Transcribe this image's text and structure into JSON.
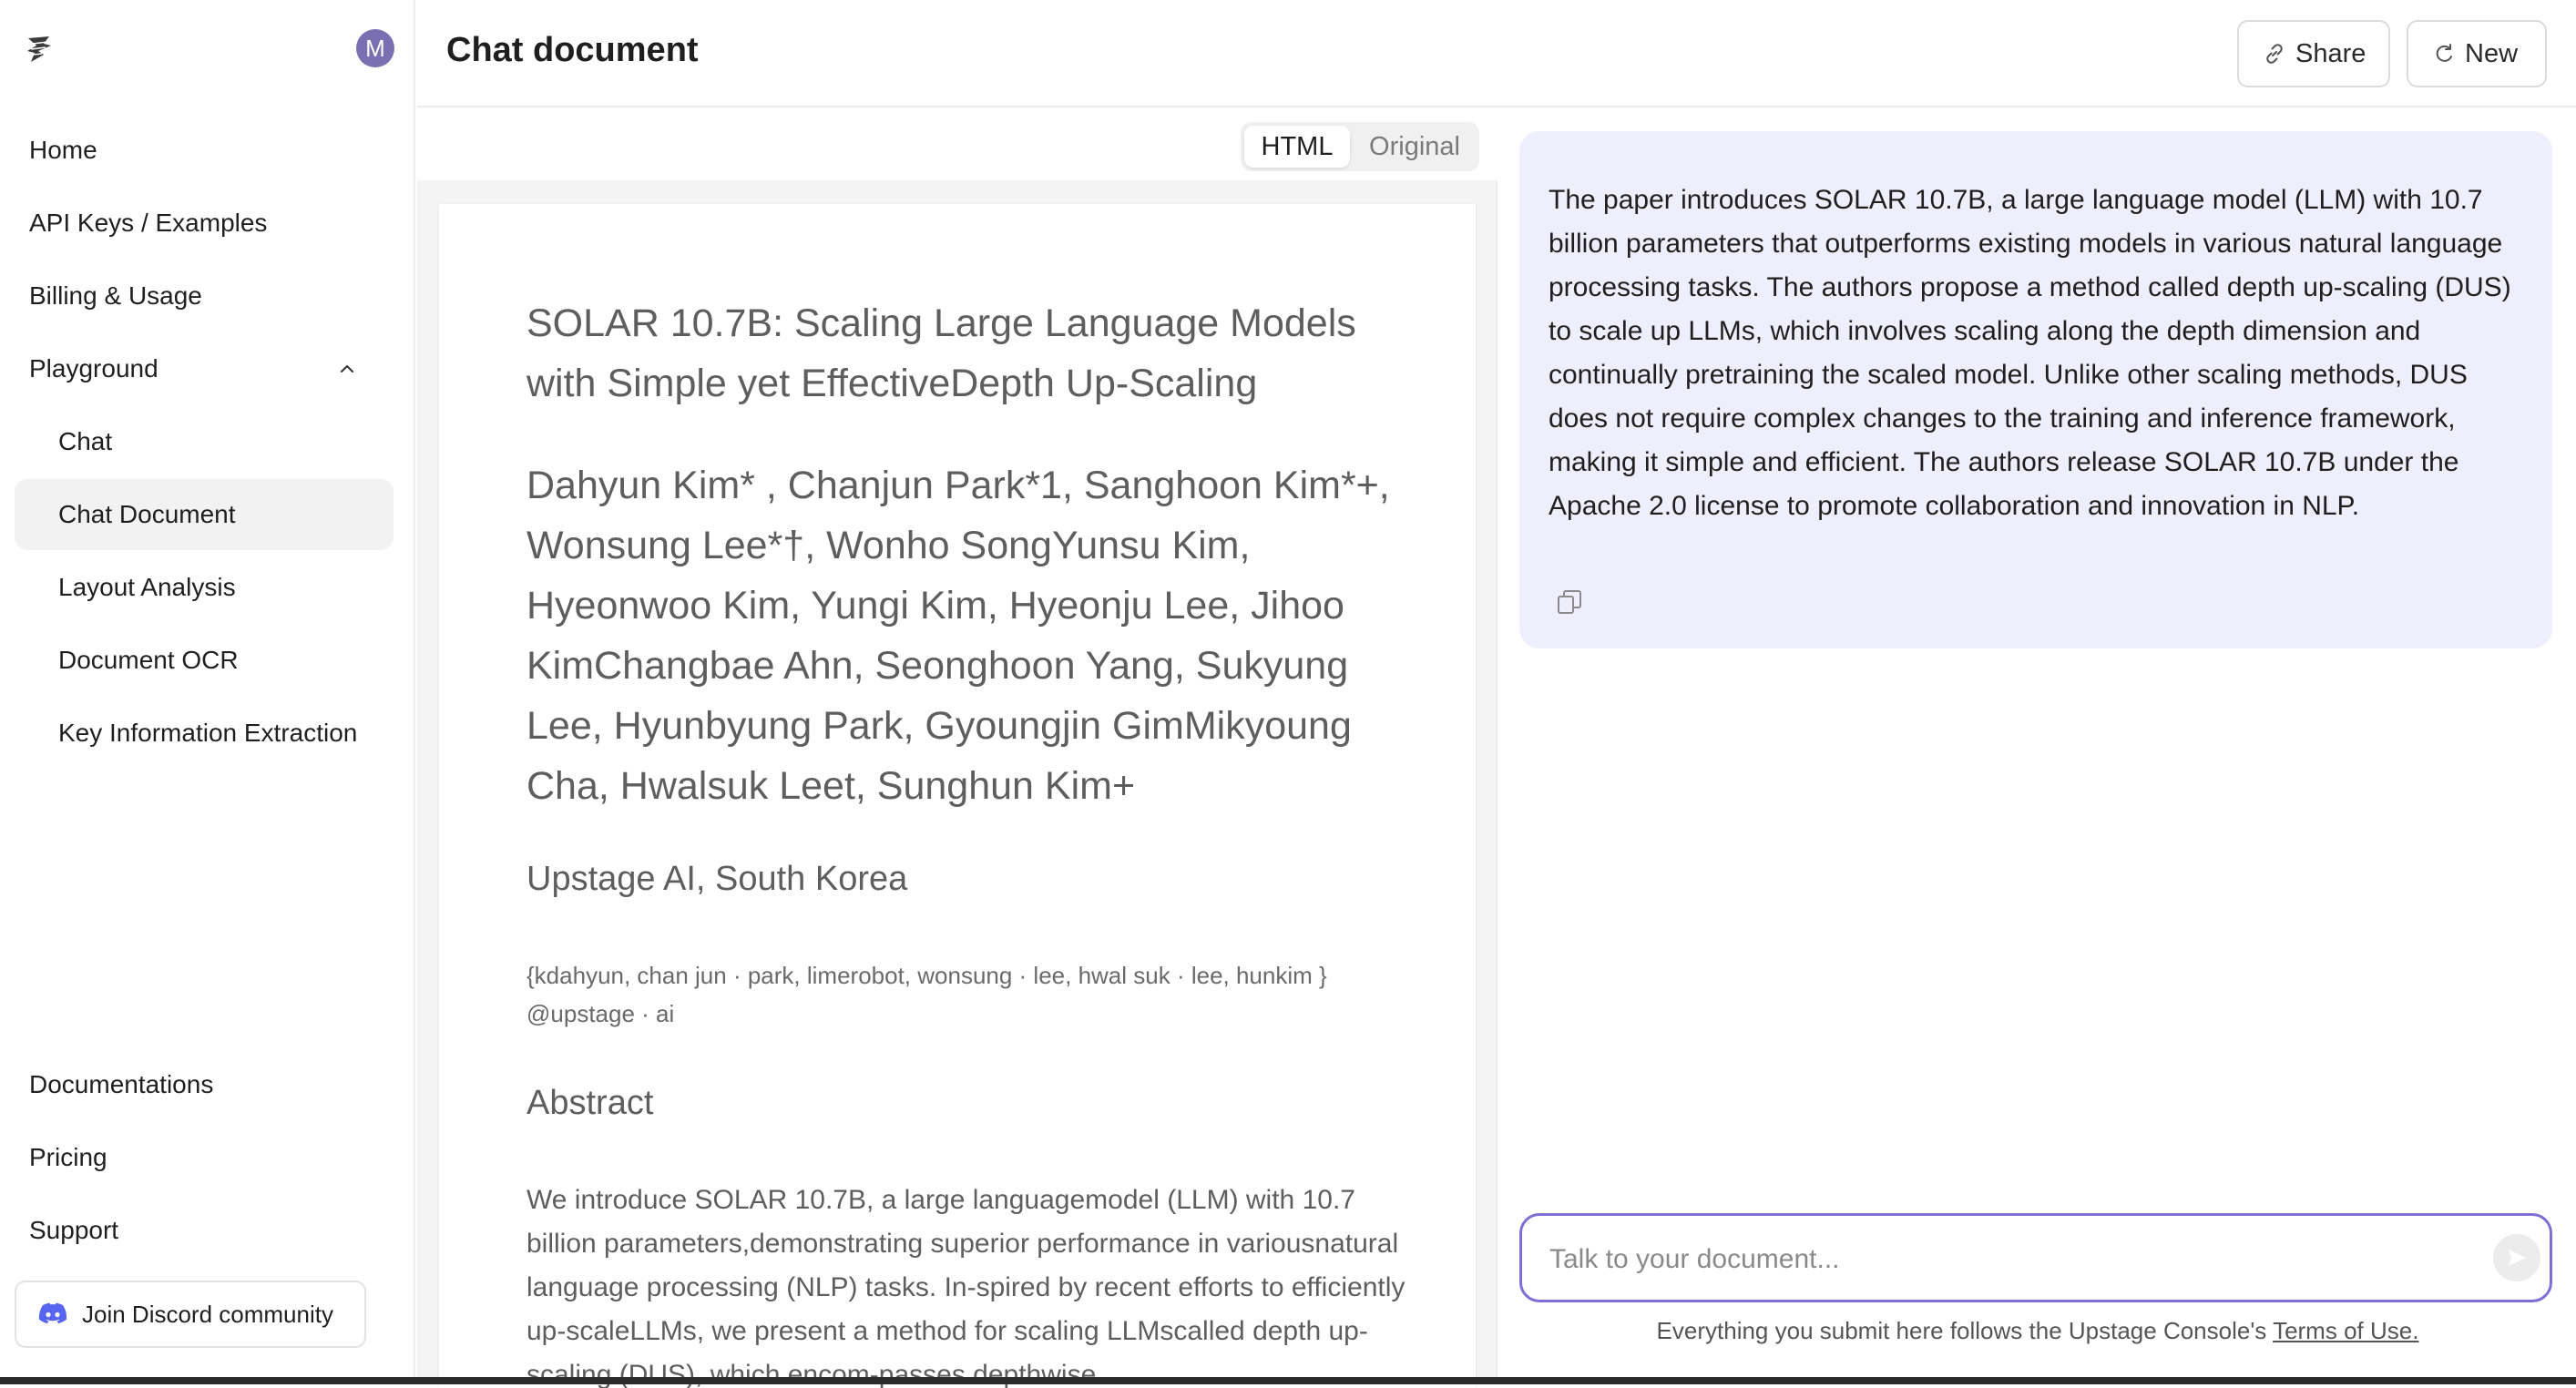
{
  "sidebar": {
    "avatar_initial": "M",
    "nav": {
      "home": "Home",
      "api_keys": "API Keys / Examples",
      "billing": "Billing & Usage",
      "playground": "Playground",
      "chat": "Chat",
      "chat_document": "Chat Document",
      "layout_analysis": "Layout Analysis",
      "document_ocr": "Document OCR",
      "key_info": "Key Information Extraction",
      "documentations": "Documentations",
      "pricing": "Pricing",
      "support": "Support"
    },
    "discord_label": "Join Discord community"
  },
  "header": {
    "title": "Chat document",
    "share_label": "Share",
    "new_label": "New"
  },
  "document": {
    "view_toggle": {
      "html": "HTML",
      "original": "Original",
      "selected": "HTML"
    },
    "title": "SOLAR 10.7B: Scaling Large Language Models with Simple yet EffectiveDepth Up-Scaling",
    "authors": "Dahyun Kim* , Chanjun Park*1, Sanghoon Kim*+, Wonsung Lee*†, Wonho SongYunsu Kim, Hyeonwoo Kim, Yungi Kim, Hyeonju Lee, Jihoo KimChangbae Ahn, Seonghoon Yang, Sukyung Lee, Hyunbyung Park, Gyoungjin GimMikyoung Cha, Hwalsuk Leet, Sunghun Kim+",
    "affiliation": "Upstage AI, South Korea",
    "emails": "{kdahyun, chan jun · park, limerobot, wonsung · lee, hwal suk · lee, hunkim } @upstage · ai",
    "abstract_heading": "Abstract",
    "abstract_text": "We introduce SOLAR 10.7B, a large languagemodel (LLM) with 10.7 billion parameters,demonstrating superior performance in variousnatural language processing (NLP) tasks. In-spired by recent efforts to efficiently up-scaleLLMs, we present a method for scaling LLMscalled depth up-scaling (DUS), which encom-passes depthwise"
  },
  "chat": {
    "response": "The paper introduces SOLAR 10.7B, a large language model (LLM) with 10.7 billion parameters that outperforms existing models in various natural language processing tasks. The authors propose a method called depth up-scaling (DUS) to scale up LLMs, which involves scaling along the depth dimension and continually pretraining the scaled model. Unlike other scaling methods, DUS does not require complex changes to the training and inference framework, making it simple and efficient. The authors release SOLAR 10.7B under the Apache 2.0 license to promote collaboration and innovation in NLP.",
    "input_placeholder": "Talk to your document...",
    "input_value": "",
    "terms_prefix": "Everything you submit here follows the Upstage Console's ",
    "terms_link": "Terms of Use."
  },
  "colors": {
    "accent": "#7c6fd6",
    "bubble_bg": "#efeefc",
    "avatar_bg": "#7a6fb0",
    "discord": "#5865f2"
  },
  "icons": [
    "logo-icon",
    "chevron-up-icon",
    "discord-icon",
    "link-icon",
    "refresh-icon",
    "copy-icon",
    "send-icon"
  ]
}
